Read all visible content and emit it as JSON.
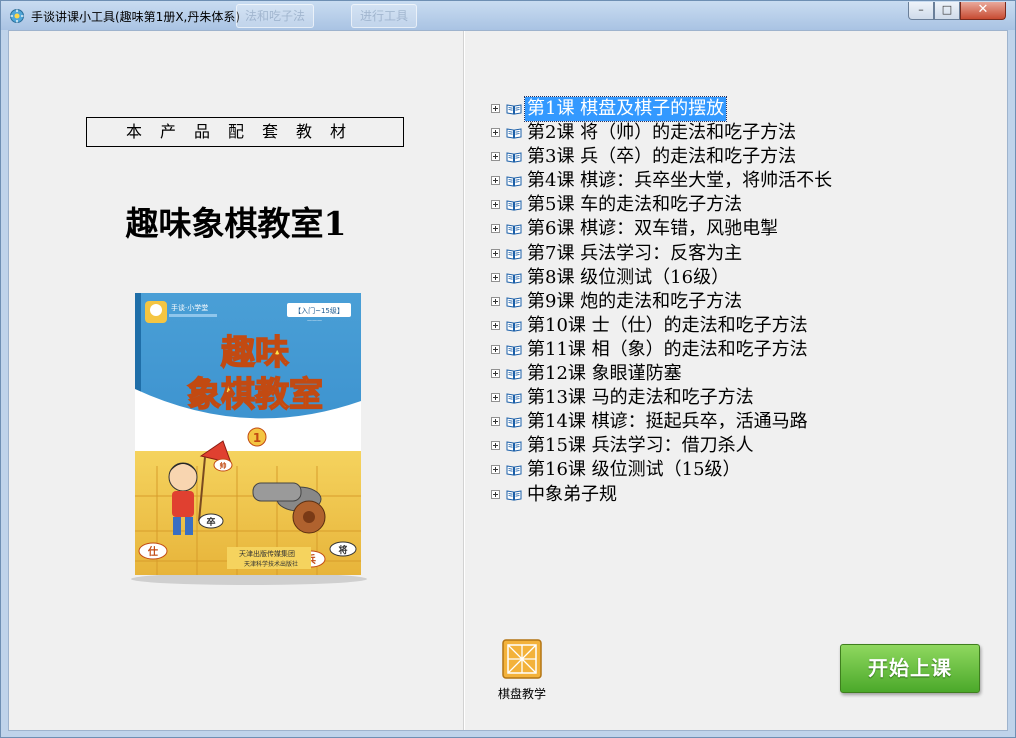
{
  "window": {
    "title": "手谈讲课小工具(趣味第1册X,丹朱体系)",
    "ghost_tabs": [
      "法和吃子法",
      "进行工具"
    ],
    "controls": {
      "minimize": "–",
      "maximize": "□",
      "close": "✕"
    }
  },
  "left_panel": {
    "supplement_label": "本产品配套教材",
    "book_title": "趣味象棋教室1",
    "cover": {
      "series_badge": "手谈·小学堂",
      "level_tag": "【入门~15级】",
      "title_line1": "趣味",
      "title_line2": "象棋教室",
      "volume": "1",
      "publisher": "天津出版传媒集团",
      "press": "天津科学技术出版社",
      "pieces": [
        "仕",
        "卒",
        "兵",
        "将",
        "帅"
      ]
    }
  },
  "lessons": [
    {
      "label": "第1课  棋盘及棋子的摆放",
      "selected": true
    },
    {
      "label": "第2课  将（帅）的走法和吃子方法",
      "selected": false
    },
    {
      "label": "第3课  兵（卒）的走法和吃子方法",
      "selected": false
    },
    {
      "label": "第4课  棋谚：兵卒坐大堂，将帅活不长",
      "selected": false
    },
    {
      "label": "第5课  车的走法和吃子方法",
      "selected": false
    },
    {
      "label": "第6课  棋谚：双车错，风驰电掣",
      "selected": false
    },
    {
      "label": "第7课  兵法学习：反客为主",
      "selected": false
    },
    {
      "label": "第8课  级位测试（16级）",
      "selected": false
    },
    {
      "label": "第9课  炮的走法和吃子方法",
      "selected": false
    },
    {
      "label": "第10课  士（仕）的走法和吃子方法",
      "selected": false
    },
    {
      "label": "第11课  相（象）的走法和吃子方法",
      "selected": false
    },
    {
      "label": "第12课  象眼谨防塞",
      "selected": false
    },
    {
      "label": "第13课  马的走法和吃子方法",
      "selected": false
    },
    {
      "label": "第14课  棋谚：挺起兵卒，活通马路",
      "selected": false
    },
    {
      "label": "第15课  兵法学习：借刀杀人",
      "selected": false
    },
    {
      "label": "第16课  级位测试（15级）",
      "selected": false
    },
    {
      "label": "中象弟子规",
      "selected": false
    }
  ],
  "tools": {
    "board_teaching_label": "棋盘教学"
  },
  "start_button": {
    "label": "开始上课"
  },
  "colors": {
    "selection": "#3399ff",
    "start_button": "#5cb833",
    "title_bar": "#bcd2ec"
  }
}
